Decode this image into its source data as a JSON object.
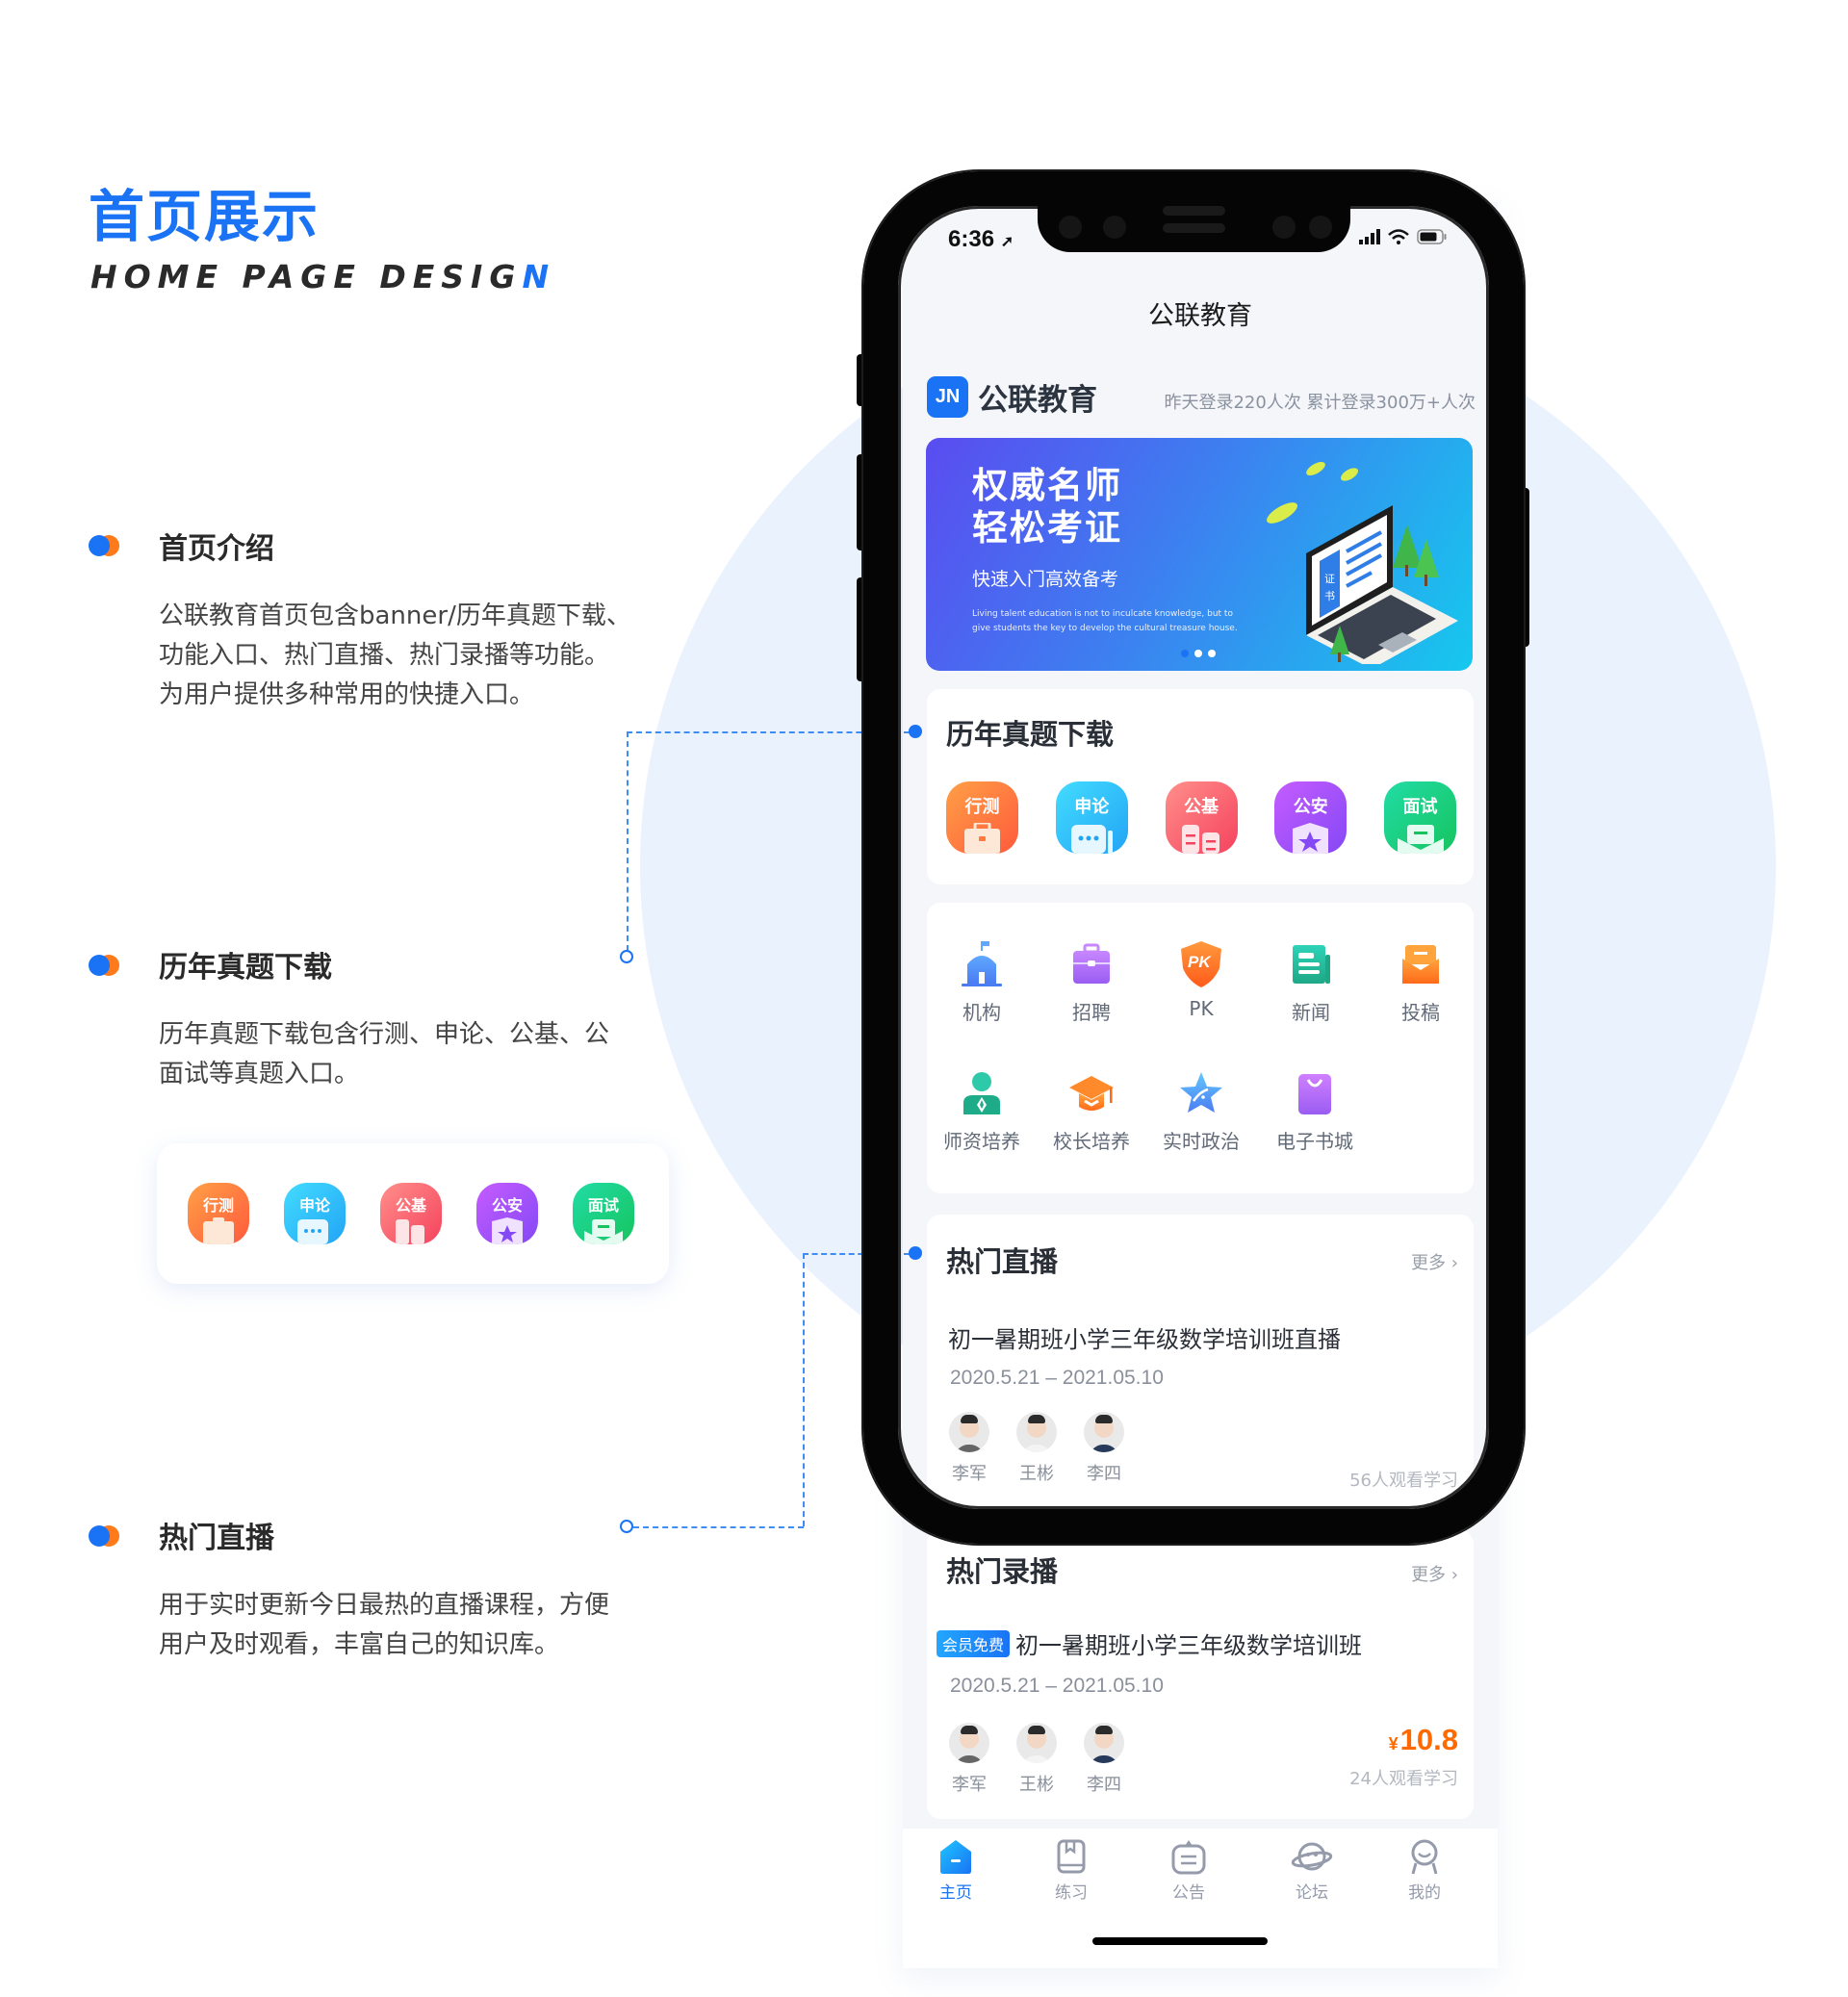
{
  "page": {
    "title_cn": "首页展示",
    "title_en_main": "HOME PAGE DESIG",
    "title_en_accent": "N"
  },
  "sections": [
    {
      "heading": "首页介绍",
      "body_lines": [
        "公联教育首页包含banner/历年真题下载、",
        "功能入口、热门直播、热门录播等功能。",
        "为用户提供多种常用的快捷入口。"
      ]
    },
    {
      "heading": "历年真题下载",
      "body_lines": [
        "历年真题下载包含行测、申论、公基、公",
        "面试等真题入口。"
      ]
    },
    {
      "heading": "热门直播",
      "body_lines": [
        "用于实时更新今日最热的直播课程，方便",
        "用户及时观看，丰富自己的知识库。"
      ]
    }
  ],
  "status_bar": {
    "time": "6:36"
  },
  "app": {
    "nav_title": "公联教育",
    "brand": {
      "logo_text": "JN",
      "name": "公联教育",
      "stats": "昨天登录220人次  累计登录300万+人次"
    },
    "banner": {
      "headline_1": "权威名师",
      "headline_2": "轻松考证",
      "subtitle": "快速入门高效备考",
      "english_1": "Living talent education is not to inculcate knowledge, but to",
      "english_2": "give students the key to develop the cultural treasure house.",
      "certificate_text": "证书",
      "pages": 3,
      "active_page": 1
    },
    "exam_download": {
      "title": "历年真题下载",
      "items": [
        {
          "label": "行测",
          "icon": "briefcase-icon",
          "color_from": "#ffa046",
          "color_to": "#ff5a3c"
        },
        {
          "label": "申论",
          "icon": "chat-bubble-icon",
          "color_from": "#43dcff",
          "color_to": "#22a4f5"
        },
        {
          "label": "公基",
          "icon": "building-icon",
          "color_from": "#ff8f8a",
          "color_to": "#f5425e"
        },
        {
          "label": "公安",
          "icon": "police-badge-icon",
          "color_from": "#c55cff",
          "color_to": "#8448f5"
        },
        {
          "label": "面试",
          "icon": "envelope-icon",
          "color_from": "#21dca6",
          "color_to": "#16c45e"
        }
      ]
    },
    "functions": [
      {
        "label": "机构",
        "icon": "institution-icon"
      },
      {
        "label": "招聘",
        "icon": "recruit-briefcase-icon"
      },
      {
        "label": "PK",
        "icon": "pk-shield-icon"
      },
      {
        "label": "新闻",
        "icon": "news-icon"
      },
      {
        "label": "投稿",
        "icon": "submit-mail-icon"
      },
      {
        "label": "师资培养",
        "icon": "teacher-icon"
      },
      {
        "label": "校长培养",
        "icon": "graduation-cap-icon"
      },
      {
        "label": "实时政治",
        "icon": "star-icon"
      },
      {
        "label": "电子书城",
        "icon": "shopping-bag-icon"
      }
    ],
    "live": {
      "title": "热门直播",
      "more": "更多",
      "course": {
        "title": "初一暑期班小学三年级数学培训班直播",
        "date": "2020.5.21  –  2021.05.10",
        "teachers": [
          "李军",
          "王彬",
          "李四"
        ],
        "watchers": "56人观看学习"
      }
    },
    "recorded": {
      "title": "热门录播",
      "more": "更多",
      "course": {
        "badge": "会员免费",
        "title": "初一暑期班小学三年级数学培训班",
        "date": "2020.5.21  –  2021.05.10",
        "teachers": [
          "李军",
          "王彬",
          "李四"
        ],
        "currency": "¥",
        "price": "10.8",
        "watchers": "24人观看学习"
      }
    },
    "tabbar": [
      {
        "label": "主页",
        "icon": "home-icon",
        "active": true
      },
      {
        "label": "练习",
        "icon": "practice-book-icon",
        "active": false
      },
      {
        "label": "公告",
        "icon": "announcement-icon",
        "active": false
      },
      {
        "label": "论坛",
        "icon": "forum-icon",
        "active": false
      },
      {
        "label": "我的",
        "icon": "profile-icon",
        "active": false
      }
    ]
  },
  "colors": {
    "accent": "#1a73f5",
    "secondary_accent": "#ff7a1a",
    "price": "#ff6a00",
    "background_circle": "#eaf2fd"
  }
}
